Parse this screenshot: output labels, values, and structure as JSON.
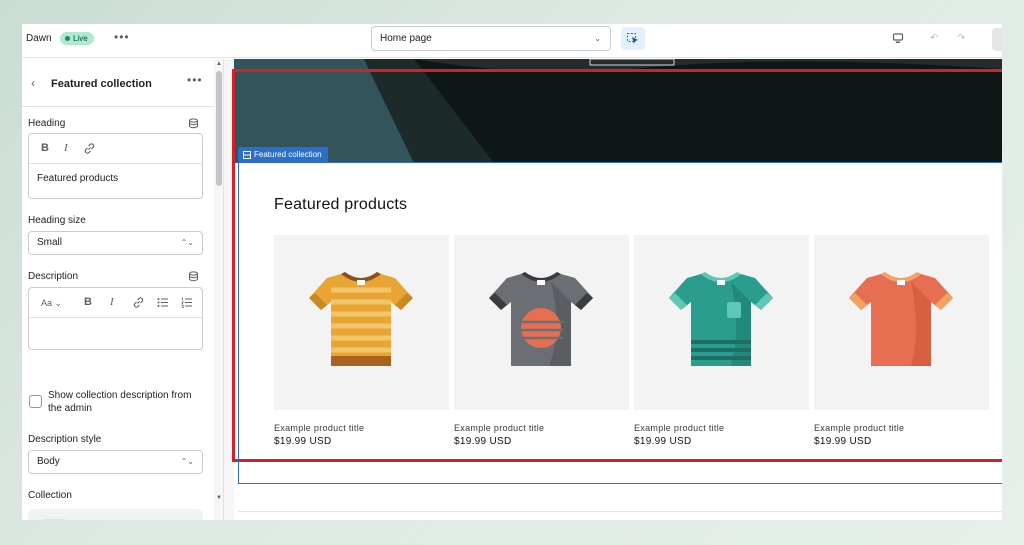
{
  "topbar": {
    "theme_name": "Dawn",
    "live_badge": "Live",
    "more_label": "•••",
    "page_select": "Home page",
    "page_chevron": "⌄"
  },
  "sidebar": {
    "title": "Featured collection",
    "more_label": "•••",
    "heading_label": "Heading",
    "heading_value": "Featured products",
    "heading_size_label": "Heading size",
    "heading_size_value": "Small",
    "description_label": "Description",
    "description_value": "",
    "show_description_label": "Show collection description from the admin",
    "show_description_checked": false,
    "description_style_label": "Description style",
    "description_style_value": "Body",
    "collection_label": "Collection"
  },
  "preview": {
    "section_tag": "Featured collection",
    "heading": "Featured products",
    "products": [
      {
        "title": "Example product title",
        "price": "$19.99 USD",
        "color": "#e8a534"
      },
      {
        "title": "Example product title",
        "price": "$19.99 USD",
        "color": "#6b6e72"
      },
      {
        "title": "Example product title",
        "price": "$19.99 USD",
        "color": "#2a9d8f"
      },
      {
        "title": "Example product title",
        "price": "$19.99 USD",
        "color": "#e76f51"
      }
    ]
  },
  "colors": {
    "accent": "#2c6ecb",
    "highlight_frame": "#d5202a",
    "live_badge_bg": "#aee9d1"
  }
}
